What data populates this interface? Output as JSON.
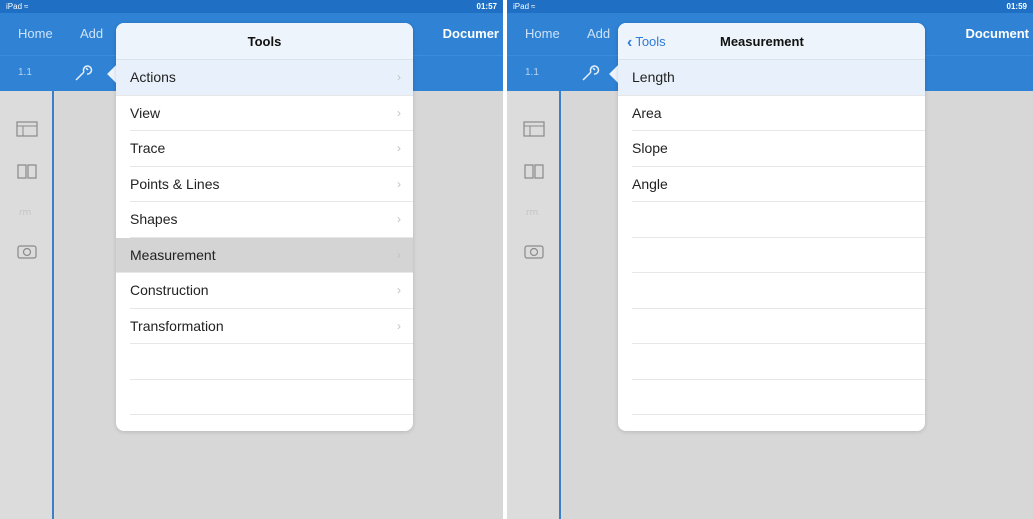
{
  "left": {
    "status": {
      "carrier": "iPad",
      "time": "01:57"
    },
    "topbar": {
      "home": "Home",
      "add": "Add",
      "document": "Documer"
    },
    "toolbar": {
      "page": "1.1"
    },
    "popover": {
      "title": "Tools",
      "items": [
        {
          "label": "Actions",
          "chevron": "›"
        },
        {
          "label": "View",
          "chevron": "›"
        },
        {
          "label": "Trace",
          "chevron": "›"
        },
        {
          "label": "Points & Lines",
          "chevron": "›"
        },
        {
          "label": "Shapes",
          "chevron": "›"
        },
        {
          "label": "Measurement",
          "chevron": "›"
        },
        {
          "label": "Construction",
          "chevron": "›"
        },
        {
          "label": "Transformation",
          "chevron": "›"
        }
      ]
    }
  },
  "right": {
    "status": {
      "carrier": "iPad",
      "time": "01:59"
    },
    "topbar": {
      "home": "Home",
      "add": "Add",
      "document": "Document"
    },
    "toolbar": {
      "page": "1.1"
    },
    "popover": {
      "back_label": "Tools",
      "title": "Measurement",
      "items": [
        {
          "label": "Length"
        },
        {
          "label": "Area"
        },
        {
          "label": "Slope"
        },
        {
          "label": "Angle"
        }
      ]
    }
  },
  "colors": {
    "bar": "#2f82d4",
    "accent": "#2f7bd8",
    "highlight": "#d4d4d4"
  },
  "icons": [
    "wrench-icon",
    "layout-icon",
    "book-icon",
    "script-icon",
    "camera-icon",
    "chevron-left-icon",
    "chevron-right-icon",
    "wifi-icon"
  ]
}
